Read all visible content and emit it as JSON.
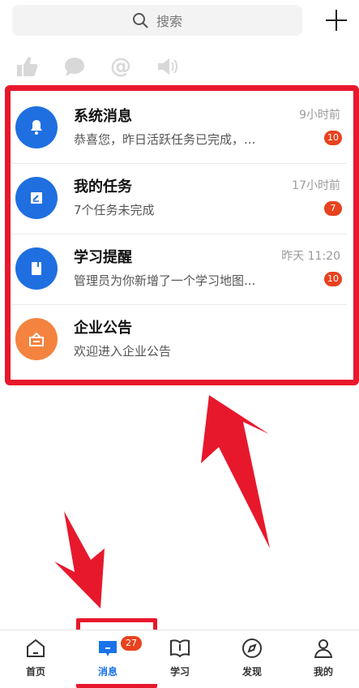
{
  "search": {
    "label": "搜索",
    "icon": "search-icon"
  },
  "reactions": [
    {
      "name": "like-icon"
    },
    {
      "name": "comment-icon"
    },
    {
      "name": "mention-icon"
    },
    {
      "name": "announcement-icon"
    }
  ],
  "messages": [
    {
      "title": "系统消息",
      "time": "9小时前",
      "subtitle": "恭喜您，昨日活跃任务已完成，...",
      "badge": "10",
      "color": "#1f6fe0",
      "icon": "bell-icon"
    },
    {
      "title": "我的任务",
      "time": "17小时前",
      "subtitle": "7个任务未完成",
      "badge": "7",
      "color": "#1f6fe0",
      "icon": "task-icon"
    },
    {
      "title": "学习提醒",
      "time": "昨天 11:20",
      "subtitle": "管理员为你新增了一个学习地图...",
      "badge": "10",
      "color": "#1f6fe0",
      "icon": "book-icon"
    },
    {
      "title": "企业公告",
      "time": "",
      "subtitle": "欢迎进入企业公告",
      "badge": "",
      "color": "#f4833f",
      "icon": "announcement-box-icon"
    }
  ],
  "nav": {
    "home": "首页",
    "messages": "消息",
    "messages_badge": "27",
    "study": "学习",
    "discover": "发现",
    "mine": "我的"
  },
  "colors": {
    "accent": "#1a73e8",
    "badge": "#e8421f",
    "highlight": "#e8182c",
    "orange": "#f4833f"
  }
}
